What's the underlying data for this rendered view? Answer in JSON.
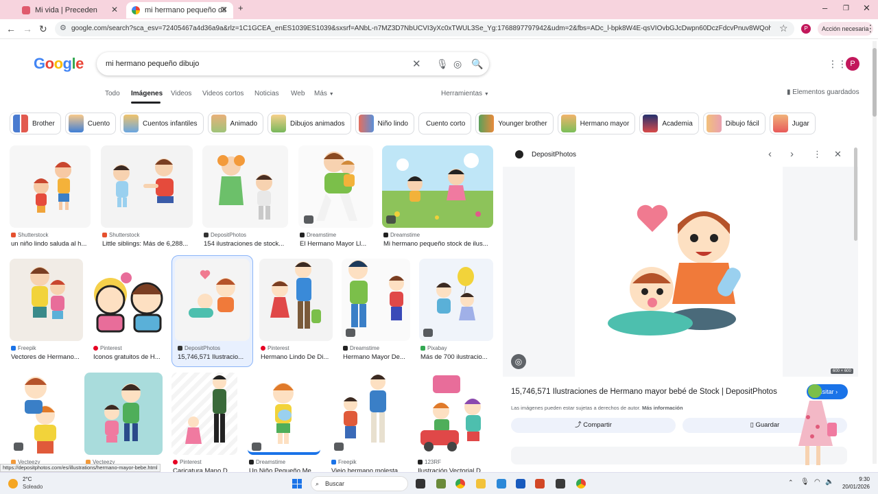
{
  "browser": {
    "tabs": [
      {
        "title": "Mi vida | Preceden"
      },
      {
        "title": "mi hermano pequeño dibujo -"
      }
    ],
    "url": "google.com/search?sca_esv=72405467a4d36a9a&rlz=1C1GCEA_enES1039ES1039&sxsrf=ANbL-n7MZ3D7NbUCVI3yXc0xTWUL3Se_Yg:1768897797942&udm=2&fbs=ADc_l-bpk8W4E-qsVIOvbGJcDwpn60DczFdcvPnuv8WQohHLTaMb_WtLz8zQ41bN...",
    "action_label": "Acción necesaria",
    "profile_initial": "P"
  },
  "google": {
    "logo": "Google",
    "query": "mi hermano pequeño dibujo",
    "tabs": [
      "Todo",
      "Imágenes",
      "Videos",
      "Videos cortos",
      "Noticias",
      "Web",
      "Más"
    ],
    "tools": "Herramientas",
    "saved": "Elementos guardados",
    "profile_initial": "P"
  },
  "chips": [
    "Brother",
    "Cuento",
    "Cuentos infantiles",
    "Animado",
    "Dibujos animados",
    "Niño lindo",
    "Cuento corto",
    "Younger brother",
    "Hermano mayor",
    "Academia",
    "Dibujo fácil",
    "Jugar"
  ],
  "results": [
    {
      "source": "Shutterstock",
      "title": "un niño lindo saluda al h..."
    },
    {
      "source": "Shutterstock",
      "title": "Little siblings: Más de 6,288..."
    },
    {
      "source": "DepositPhotos",
      "title": "154 ilustraciones de stock..."
    },
    {
      "source": "Dreamstime",
      "title": "El Hermano Mayor Ll..."
    },
    {
      "source": "Dreamstime",
      "title": "Mi hermano pequeño stock de ilus..."
    },
    {
      "source": "Freepik",
      "title": "Vectores de Hermano..."
    },
    {
      "source": "Pinterest",
      "title": "Iconos gratuitos de H..."
    },
    {
      "source": "DepositPhotos",
      "title": "15,746,571 Ilustracio..."
    },
    {
      "source": "Pinterest",
      "title": "Hermano Lindo De Di..."
    },
    {
      "source": "Dreamstime",
      "title": "Hermano Mayor De..."
    },
    {
      "source": "Pixabay",
      "title": "Más de 700 ilustracio..."
    },
    {
      "source": "Vecteezy",
      "title": ""
    },
    {
      "source": "Vecteezy",
      "title": ""
    },
    {
      "source": "Pinterest",
      "title": "Caricatura Mano D..."
    },
    {
      "source": "Dreamstime",
      "title": "Un Niño Pequeño Me..."
    },
    {
      "source": "Freepik",
      "title": "Viejo hermano molesta..."
    },
    {
      "source": "123RF",
      "title": "Ilustración Vectorial D..."
    }
  ],
  "preview": {
    "source": "DepositPhotos",
    "title": "15,746,571 Ilustraciones de Hermano mayor bebé de Stock | DepositPhotos",
    "visit": "Visitar",
    "rights": "Las imágenes pueden estar sujetas a derechos de autor.",
    "more_info": "Más información",
    "share": "Compartir",
    "save": "Guardar",
    "dims": "600 × 600"
  },
  "status_url": "https://depositphotos.com/es/illustrations/hermano-mayor-bebe.html",
  "taskbar": {
    "temp": "2°C",
    "weather": "Soleado",
    "search": "Buscar",
    "time": "9:30",
    "date": "20/01/2026"
  },
  "colors": {
    "tabbar": "#f7d4de",
    "accent": "#1a73e8",
    "profile": "#c2185b"
  }
}
